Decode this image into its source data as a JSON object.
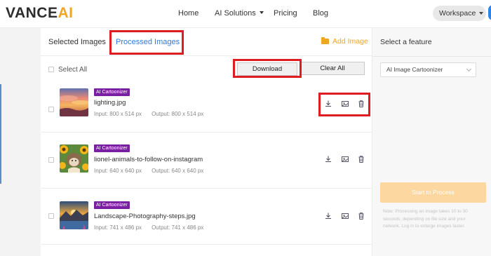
{
  "header": {
    "logo": {
      "part1": "VANCE",
      "part2": "AI"
    },
    "nav": [
      {
        "label": "Home"
      },
      {
        "label": "AI Solutions",
        "has_dropdown": true
      },
      {
        "label": "Pricing"
      },
      {
        "label": "Blog"
      }
    ],
    "workspace_label": "Workspace",
    "avatar_icon": "user-avatar-icon"
  },
  "tabs": {
    "selected": "Selected Images",
    "processed": "Processed Images",
    "active": "processed"
  },
  "add_image": {
    "label": "Add Image",
    "icon": "folder-icon"
  },
  "toolbar": {
    "select_all": "Select All",
    "download": "Download",
    "clear_all": "Clear All"
  },
  "images": [
    {
      "badge": "AI Cartoonizer",
      "filename": "lighting.jpg",
      "input": "Input: 800 x 514 px",
      "output": "Output: 800 x 514 px",
      "thumbnail": "sunset-clouds"
    },
    {
      "badge": "AI Cartoonizer",
      "filename": "lionel-animals-to-follow-on-instagram",
      "input": "Input: 640 x 640 px",
      "output": "Output: 640 x 640 px",
      "thumbnail": "hedgehog-sunflowers"
    },
    {
      "badge": "AI Cartoonizer",
      "filename": "Landscape-Photography-steps.jpg",
      "input": "Input: 741 x 486 px",
      "output": "Output: 741 x 486 px",
      "thumbnail": "mountain-lake-sunset"
    }
  ],
  "row_action_icons": [
    "download-icon",
    "compare-icon",
    "delete-icon"
  ],
  "sidebar": {
    "title": "Select a feature",
    "feature_selected": "AI Image Cartoonizer",
    "start_button": "Start to Process",
    "note": "Note: Processing an image takes 10 to 30 seconds, depending on file size and your network. Log in to enlarge images faster."
  },
  "colors": {
    "brand_orange": "#f0a523",
    "active_tab_blue": "#2a7ae2",
    "highlight_red": "#e01c23",
    "badge_purple": "#7b1fa2",
    "start_button_disabled": "#fcd7a0"
  }
}
